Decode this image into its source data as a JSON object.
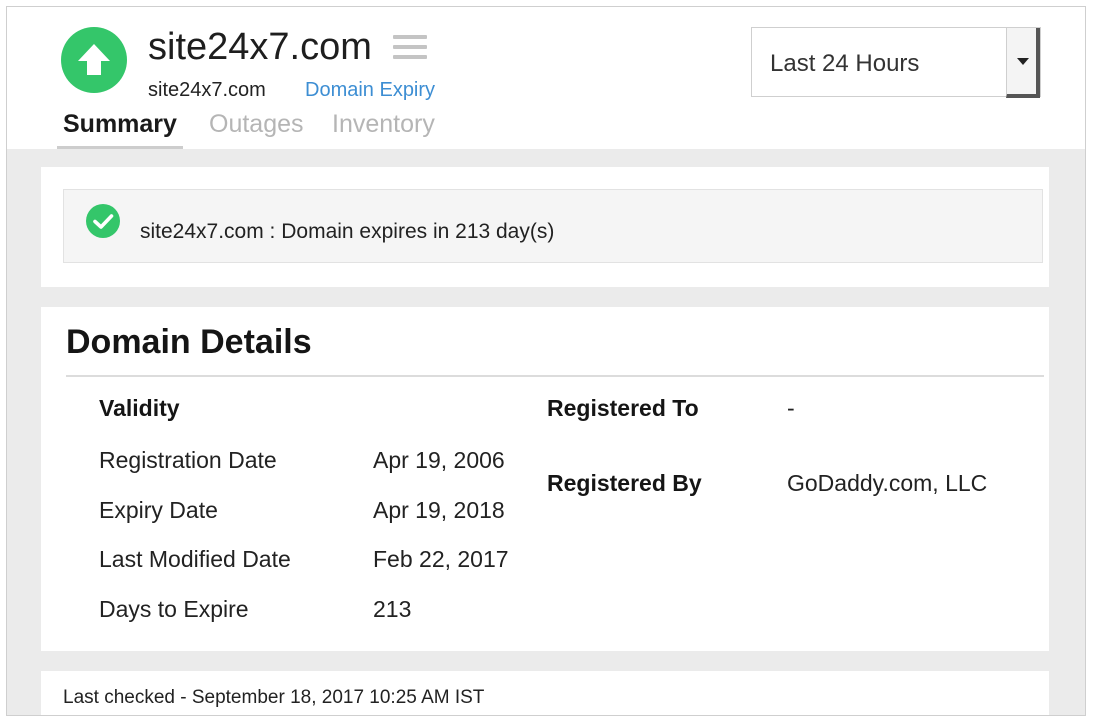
{
  "header": {
    "title": "site24x7.com",
    "subtitle": "site24x7.com",
    "monitor_type": "Domain Expiry",
    "status_color": "#34c66a",
    "status_icon": "arrow-up-icon",
    "menu_icon": "hamburger-menu-icon"
  },
  "tabs": [
    {
      "label": "Summary",
      "active": true
    },
    {
      "label": "Outages",
      "active": false
    },
    {
      "label": "Inventory",
      "active": false
    }
  ],
  "time_range": {
    "selected": "Last 24 Hours"
  },
  "alert": {
    "icon": "check-circle-icon",
    "color": "#34c66a",
    "message": "site24x7.com : Domain expires in 213 day(s)"
  },
  "domain_details": {
    "title": "Domain Details",
    "validity_heading": "Validity",
    "rows": [
      {
        "label": "Registration Date",
        "value": "Apr 19, 2006"
      },
      {
        "label": "Expiry Date",
        "value": "Apr 19, 2018"
      },
      {
        "label": "Last Modified Date",
        "value": "Feb 22, 2017"
      },
      {
        "label": "Days to Expire",
        "value": "213"
      }
    ],
    "registered_to_label": "Registered To",
    "registered_to_value": "-",
    "registered_by_label": "Registered By",
    "registered_by_value": "GoDaddy.com, LLC"
  },
  "footer": {
    "last_checked": "Last checked - September 18, 2017 10:25 AM IST"
  },
  "colors": {
    "accent_link": "#3d8ed3",
    "background": "#ebebeb"
  }
}
